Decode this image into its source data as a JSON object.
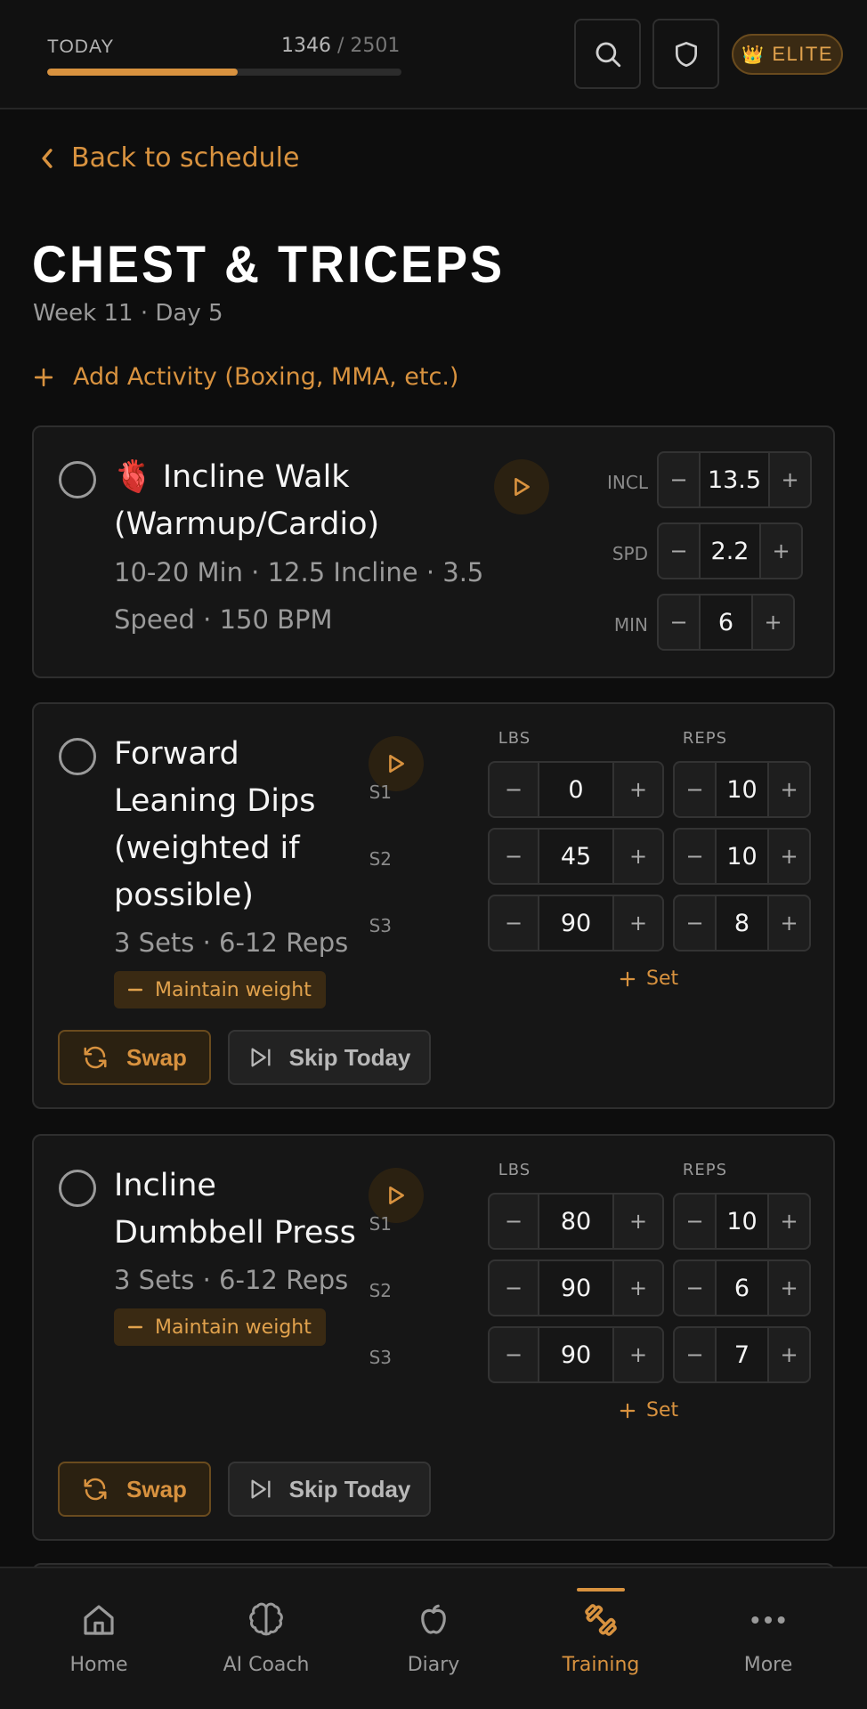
{
  "topbar": {
    "today_label": "TODAY",
    "calories_current": "1346",
    "calories_goal": "/ 2501",
    "progress_fraction": 0.538,
    "elite_badge": "ELITE",
    "crown_glyph": "👑"
  },
  "header": {
    "back_label": "Back to schedule",
    "title": "CHEST & TRICEPS",
    "subtitle": "Week 11 · Day 5",
    "add_activity": "Add Activity (Boxing, MMA, etc.)"
  },
  "exercises": [
    {
      "emoji": "🫀",
      "name_lines": [
        "Incline Walk",
        "(Warmup/Cardio)"
      ],
      "meta_lines": [
        "10-20 Min · 12.5 Incline · 3.5",
        "Speed · 150 BPM"
      ],
      "params": [
        {
          "label": "INCL",
          "value": "13.5"
        },
        {
          "label": "SPD",
          "value": "2.2"
        },
        {
          "label": "MIN",
          "value": "6"
        }
      ]
    },
    {
      "name_lines": [
        "Forward",
        "Leaning Dips",
        "(weighted if",
        "possible)"
      ],
      "meta": "3 Sets · 6-12 Reps",
      "chip": "Maintain weight",
      "col_lbs": "LBS",
      "col_reps": "REPS",
      "sets": [
        {
          "label": "S1",
          "lbs": "0",
          "reps": "10"
        },
        {
          "label": "S2",
          "lbs": "45",
          "reps": "10"
        },
        {
          "label": "S3",
          "lbs": "90",
          "reps": "8"
        }
      ],
      "add_set": "Set",
      "swap": "Swap",
      "skip": "Skip Today"
    },
    {
      "name_lines": [
        "Incline",
        "Dumbbell Press"
      ],
      "meta": "3 Sets · 6-12 Reps",
      "chip": "Maintain weight",
      "col_lbs": "LBS",
      "col_reps": "REPS",
      "sets": [
        {
          "label": "S1",
          "lbs": "80",
          "reps": "10"
        },
        {
          "label": "S2",
          "lbs": "90",
          "reps": "6"
        },
        {
          "label": "S3",
          "lbs": "90",
          "reps": "7"
        }
      ],
      "add_set": "Set",
      "swap": "Swap",
      "skip": "Skip Today"
    }
  ],
  "stepper_minus": "−",
  "stepper_plus": "+",
  "nav": {
    "items": [
      {
        "label": "Home",
        "icon": "home-icon"
      },
      {
        "label": "AI Coach",
        "icon": "brain-icon"
      },
      {
        "label": "Diary",
        "icon": "apple-icon"
      },
      {
        "label": "Training",
        "icon": "dumbbell-icon",
        "active": true
      },
      {
        "label": "More",
        "icon": "more-icon"
      }
    ]
  },
  "colors": {
    "accent": "#d8923f",
    "background": "#0d0d0d",
    "card": "#161616"
  }
}
